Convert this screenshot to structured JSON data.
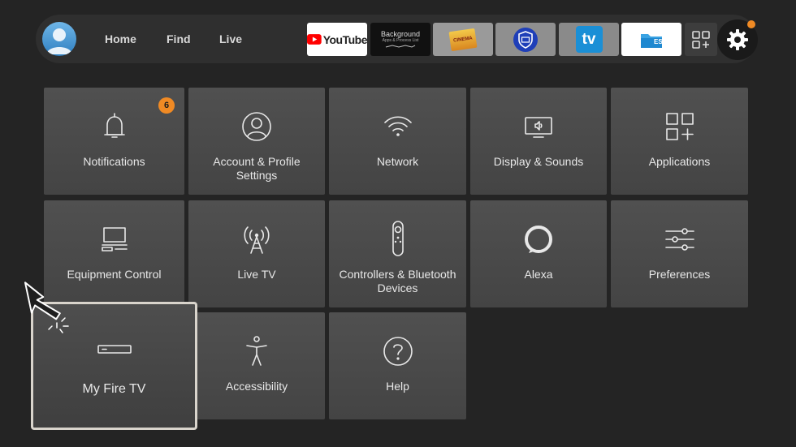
{
  "header": {
    "nav": [
      "Home",
      "Find",
      "Live"
    ],
    "apps": {
      "youtube_label": "YouTube",
      "background_title": "Background",
      "background_subtitle": "Apps & Process List",
      "cinema_label": "CINEMA",
      "tv_label": "tv",
      "fm_label": "ES"
    },
    "notification_dot_color": "#f08a24"
  },
  "settings_tiles": [
    {
      "label": "Notifications",
      "icon": "bell-icon",
      "badge": "6"
    },
    {
      "label": "Account & Profile Settings",
      "icon": "profile-icon"
    },
    {
      "label": "Network",
      "icon": "wifi-icon"
    },
    {
      "label": "Display & Sounds",
      "icon": "display-icon"
    },
    {
      "label": "Applications",
      "icon": "apps-grid-icon"
    },
    {
      "label": "Equipment Control",
      "icon": "equipment-icon"
    },
    {
      "label": "Live TV",
      "icon": "antenna-icon"
    },
    {
      "label": "Controllers & Bluetooth Devices",
      "icon": "remote-icon"
    },
    {
      "label": "Alexa",
      "icon": "alexa-icon"
    },
    {
      "label": "Preferences",
      "icon": "sliders-icon"
    },
    {
      "label": "My Fire TV",
      "icon": "fire-tv-device-icon",
      "focused": true
    },
    {
      "label": "Accessibility",
      "icon": "accessibility-icon"
    },
    {
      "label": "Help",
      "icon": "help-icon"
    }
  ],
  "colors": {
    "accent": "#f08a24",
    "focus_border": "#d9d4cc"
  }
}
